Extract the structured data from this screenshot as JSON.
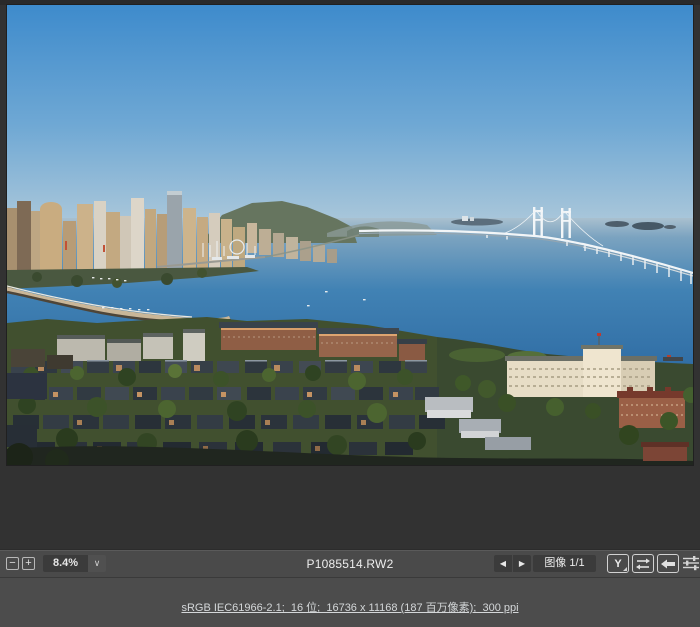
{
  "toolbar": {
    "zoom_out_glyph": "−",
    "zoom_in_glyph": "+",
    "zoom_level": "8.4%",
    "zoom_menu_glyph": "∨",
    "filename": "P1085514.RW2",
    "prev_glyph": "◀",
    "next_glyph": "▶",
    "image_counter": "图像 1/1",
    "cycle_view_label": "Y"
  },
  "footer": {
    "image_info": "sRGB IEC61966-2.1;  16 位;  16736 x 11168 (187 百万像素);  300 ppi"
  },
  "icons": {
    "swap": "swap-before-after-arrows-icon",
    "copy": "copy-settings-left-arrow-icon",
    "sliders": "settings-sliders-icon"
  },
  "colors": {
    "canvas_bg": "#333333",
    "panel_bg": "#4a4a4a",
    "field_bg": "#3b3b3b",
    "control_border": "#d2d2d2",
    "text": "#ececec",
    "link_text": "#d4d7d9",
    "sky_top": "#3e8bcc",
    "sea": "#3c7eb4"
  }
}
